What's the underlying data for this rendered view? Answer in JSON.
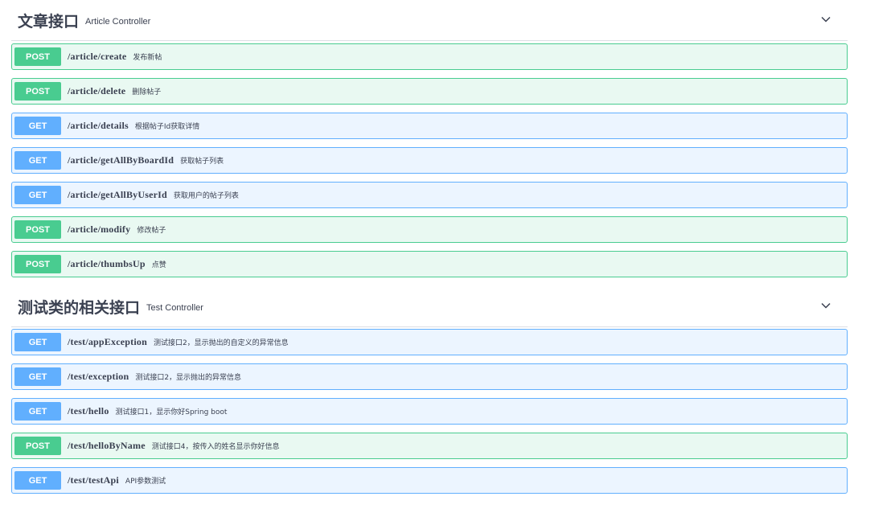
{
  "sections": [
    {
      "title": "文章接口",
      "description": "Article Controller",
      "operations": [
        {
          "method": "POST",
          "path": "/article/create",
          "summary": "发布新帖"
        },
        {
          "method": "POST",
          "path": "/article/delete",
          "summary": "删除帖子"
        },
        {
          "method": "GET",
          "path": "/article/details",
          "summary": "根据帖子Id获取详情"
        },
        {
          "method": "GET",
          "path": "/article/getAllByBoardId",
          "summary": "获取帖子列表"
        },
        {
          "method": "GET",
          "path": "/article/getAllByUserId",
          "summary": "获取用户的帖子列表"
        },
        {
          "method": "POST",
          "path": "/article/modify",
          "summary": "修改帖子"
        },
        {
          "method": "POST",
          "path": "/article/thumbsUp",
          "summary": "点赞"
        }
      ]
    },
    {
      "title": "测试类的相关接口",
      "description": "Test Controller",
      "operations": [
        {
          "method": "GET",
          "path": "/test/appException",
          "summary": "测试接口2，显示抛出的自定义的异常信息"
        },
        {
          "method": "GET",
          "path": "/test/exception",
          "summary": "测试接口2，显示抛出的异常信息"
        },
        {
          "method": "GET",
          "path": "/test/hello",
          "summary": "测试接口1，显示你好Spring boot"
        },
        {
          "method": "POST",
          "path": "/test/helloByName",
          "summary": "测试接口4，按传入的姓名显示你好信息"
        },
        {
          "method": "GET",
          "path": "/test/testApi",
          "summary": "API参数测试"
        }
      ]
    }
  ],
  "colors": {
    "post": "#49cc90",
    "get": "#61affe",
    "text": "#3b4151"
  }
}
